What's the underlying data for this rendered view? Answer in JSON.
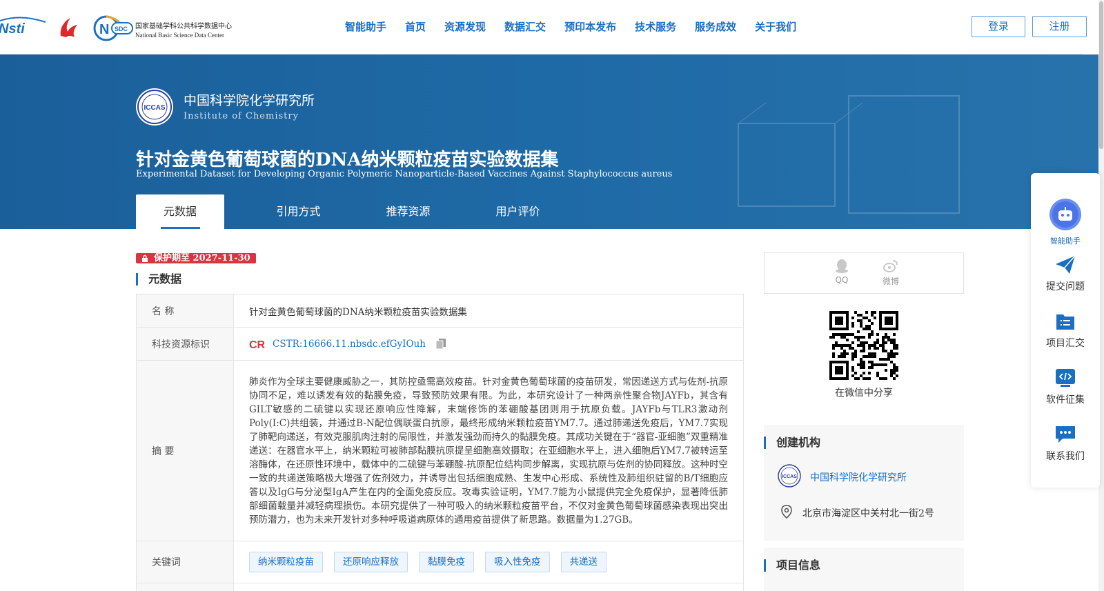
{
  "header": {
    "nav": [
      "智能助手",
      "首页",
      "资源发现",
      "数据汇交",
      "预印本发布",
      "技术服务",
      "服务成效",
      "关于我们"
    ],
    "login": "登录",
    "register": "注册",
    "logos": {
      "nstl_text": "Nsti",
      "nsdc_abbr": "NSDC",
      "nsdc_cn": "国家基础学科公共科学数据中心",
      "nsdc_en": "National Basic Science Data Center"
    }
  },
  "banner": {
    "institute_cn": "中国科学院化学研究所",
    "institute_en": "Institute of Chemistry",
    "institute_logo_text": "ICCAS",
    "title": "针对金黄色葡萄球菌的DNA纳米颗粒疫苗实验数据集",
    "subtitle": "Experimental Dataset for Developing Organic Polymeric Nanoparticle-Based Vaccines Against Staphylococcus aureus",
    "tabs": [
      "元数据",
      "引用方式",
      "推荐资源",
      "用户评价"
    ]
  },
  "main": {
    "protection": "保护期至 2027-11-30",
    "section_title": "元数据",
    "rows": {
      "name_key": "名 称",
      "name_val": "针对金黄色葡萄球菌的DNA纳米颗粒疫苗实验数据集",
      "cstr_key": "科技资源标识",
      "cstr_val": "CSTR:16666.11.nbsdc.efGyIOuh",
      "abstract_key": "摘 要",
      "abstract_val": "肺炎作为全球主要健康威胁之一，其防控亟需高效疫苗。针对金黄色葡萄球菌的疫苗研发，常因递送方式与佐剂-抗原协同不足，难以诱发有效的黏膜免疫，导致预防效果有限。为此，本研究设计了一种两亲性聚合物JAYFb，其含有GILT敏感的二硫键以实现还原响应性降解，末端修饰的苯硼酸基团则用于抗原负载。JAYFb与TLR3激动剂Poly(I:C)共组装，并通过B-N配位偶联蛋白抗原，最终形成纳米颗粒疫苗YM7.7。通过肺递送免疫后，YM7.7实现了肺靶向递送，有效克服肌肉注射的局限性，并激发强劲而持久的黏膜免疫。其成功关键在于“器官-亚细胞”双重精准递送：在器官水平上，纳米颗粒可被肺部黏膜抗原提呈细胞高效摄取；在亚细胞水平上，进入细胞后YM7.7被转运至溶酶体，在还原性环境中，载体中的二硫键与苯硼酸-抗原配位结构同步解离，实现抗原与佐剂的协同释放。这种时空一致的共递送策略极大增强了佐剂效力，并诱导出包括细胞成熟、生发中心形成、系统性及肺组织驻留的B/T细胞应答以及IgG与分泌型IgA产生在内的全面免疫反应。攻毒实验证明，YM7.7能为小鼠提供完全免疫保护，显著降低肺部细菌载量并减轻病理损伤。本研究提供了一种可吸入的纳米颗粒疫苗平台，不仅对金黄色葡萄球菌感染表现出突出预防潜力，也为未来开发针对多种呼吸道病原体的通用疫苗提供了新思路。数据量为1.27GB。",
      "keywords_key": "关键词",
      "keywords": [
        "纳米颗粒疫苗",
        "还原响应释放",
        "黏膜免疫",
        "吸入性免疫",
        "共递送"
      ]
    }
  },
  "right": {
    "share": [
      "QQ",
      "微博"
    ],
    "qr_caption": "在微信中分享",
    "org_title": "创建机构",
    "org_name": "中国科学院化学研究所",
    "org_address": "北京市海淀区中关村北一街2号",
    "project_title": "项目信息"
  },
  "float_bar": [
    "智能助手",
    "提交问题",
    "项目汇交",
    "软件征集",
    "联系我们"
  ],
  "colors": {
    "accent": "#1a6fc4",
    "banner": "#1e63a0",
    "badge": "#d9343f"
  },
  "icons": [
    "qq-icon",
    "weibo-icon",
    "copy-icon",
    "location-pin-icon",
    "robot-icon",
    "send-icon",
    "list-icon",
    "code-icon",
    "chat-icon",
    "lock-icon"
  ]
}
